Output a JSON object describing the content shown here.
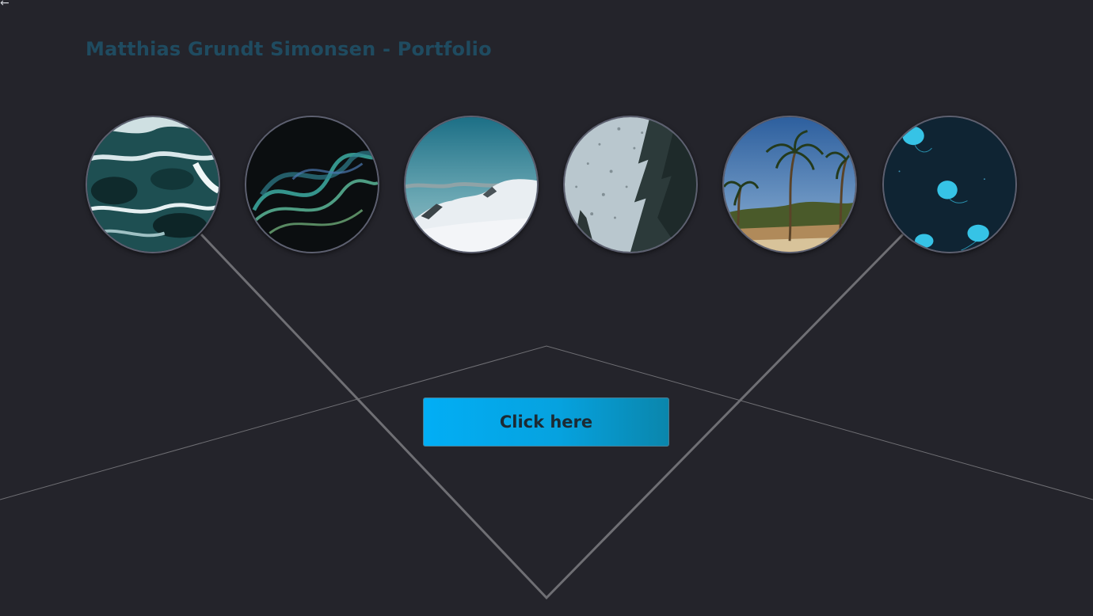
{
  "header": {
    "back_glyph": "←",
    "title": "Matthias Grundt Simonsen - Portfolio"
  },
  "gallery": [
    {
      "name": "ocean-waves",
      "icon": "ocean-photo"
    },
    {
      "name": "smoke-wave",
      "icon": "smoke-photo"
    },
    {
      "name": "snowy-mountain",
      "icon": "mountain-photo"
    },
    {
      "name": "rainy-window-trees",
      "icon": "rain-photo"
    },
    {
      "name": "palm-beach",
      "icon": "palm-photo"
    },
    {
      "name": "jellyfish",
      "icon": "jellyfish-photo"
    }
  ],
  "cta": {
    "label": "Click here"
  },
  "colors": {
    "background": "#24242b",
    "title": "#1f4b60",
    "button_start": "#02aef5",
    "button_end": "#0a86ac",
    "line": "#6f6f74"
  }
}
